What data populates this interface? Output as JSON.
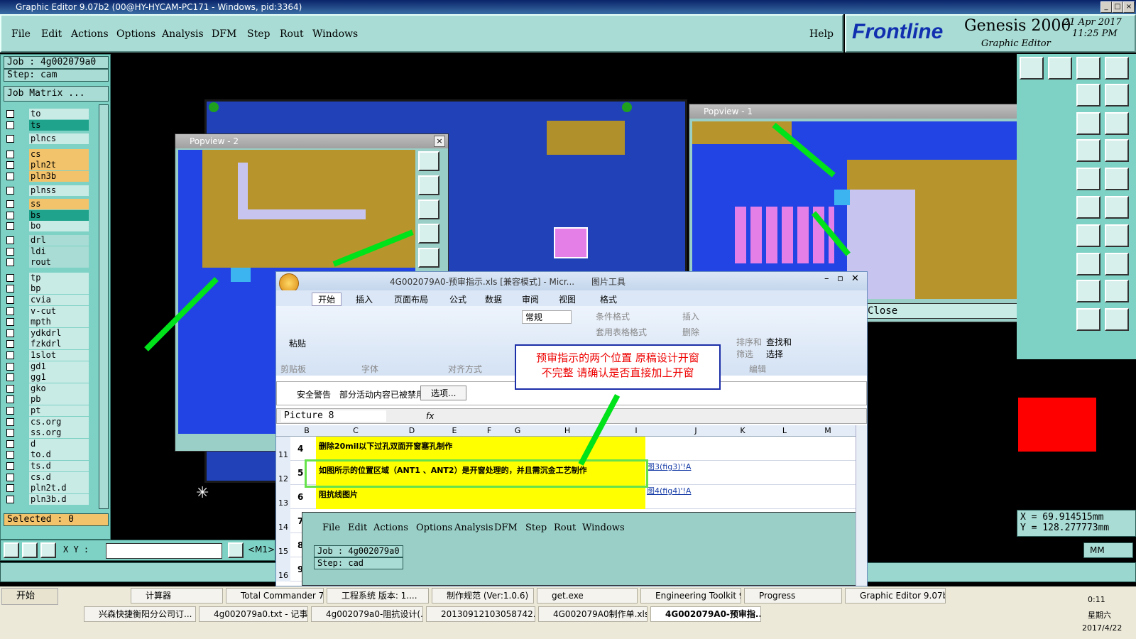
{
  "window": {
    "title": "Graphic Editor 9.07b2 (00@HY-HYCAM-PC171 - Windows, pid:3364)"
  },
  "menu": [
    "File",
    "Edit",
    "Actions",
    "Options",
    "Analysis",
    "DFM",
    "Step",
    "Rout",
    "Windows"
  ],
  "help": "Help",
  "brand": {
    "logo": "Frontline",
    "product": "Genesis 2000",
    "sub": "Graphic Editor",
    "date": "21 Apr 2017",
    "time": "11:25 PM"
  },
  "job": {
    "job": "Job : 4g002079a0",
    "step": "Step: cam",
    "matrix": "Job Matrix ...",
    "selected": "Selected : 0"
  },
  "layers": [
    "to",
    "ts",
    "plncs",
    "cs",
    "pln2t",
    "pln3b",
    "plnss",
    "ss",
    "bs",
    "bo",
    "drl",
    "ldi",
    "rout",
    "tp",
    "bp",
    "cvia",
    "v-cut",
    "mpth",
    "ydkdrl",
    "fzkdrl",
    "1slot",
    "gd1",
    "gg1",
    "gko",
    "pb",
    "pt",
    "cs.org",
    "ss.org",
    "d",
    "to.d",
    "ts.d",
    "cs.d",
    "pln2t.d",
    "pln3b.d"
  ],
  "pop1": {
    "title": "Popview - 1",
    "close": "Close"
  },
  "pop2": {
    "title": "Popview - 2"
  },
  "coords": {
    "x": "X = 69.914515mm",
    "y": "Y = 128.277773mm",
    "unit": "MM",
    "xy": "X Y :",
    "m1": "<M1>"
  },
  "excel": {
    "title": "4G002079A0-预审指示.xls [兼容模式] - Micr...",
    "tools": "图片工具",
    "tabs": [
      "开始",
      "插入",
      "页面布局",
      "公式",
      "数据",
      "审阅",
      "视图",
      "格式"
    ],
    "groups": [
      "剪贴板",
      "字体",
      "对齐方式",
      "编辑"
    ],
    "paste": "粘贴",
    "number": "常规",
    "cells": [
      "条件格式",
      "套用表格格式",
      "插入",
      "删除",
      "排序和筛选",
      "查找和选择"
    ],
    "security": {
      "label": "安全警告",
      "msg": "部分活动内容已被禁用。",
      "btn": "选项..."
    },
    "namebox": "Picture 8",
    "fx": "fx",
    "cols": [
      "B",
      "C",
      "D",
      "E",
      "F",
      "G",
      "H",
      "I",
      "J",
      "K",
      "L",
      "M"
    ],
    "rows": [
      {
        "r": "11",
        "n": "4",
        "t": "删除20mil以下过孔双面开窗塞孔制作",
        "j": ""
      },
      {
        "r": "12",
        "n": "5",
        "t": "如图所示的位置区域（ANT1 、ANT2）是开窗处理的，并且需沉金工艺制作",
        "j": "图3(fig3)'!A"
      },
      {
        "r": "13",
        "n": "6",
        "t": "阻抗线图片",
        "j": "图4(fig4)'!A"
      },
      {
        "r": "14",
        "n": "7",
        "t": "",
        "j": ""
      },
      {
        "r": "15",
        "n": "8",
        "t": "",
        "j": ""
      },
      {
        "r": "16",
        "n": "9",
        "t": "",
        "j": ""
      }
    ],
    "note1": "预审指示的两个位置  原稿设计开窗",
    "note2": "不完整  请确认是否直接加上开窗",
    "inner_job": "Job : 4g002079a0",
    "inner_step": "Step: cad"
  },
  "taskbar": {
    "start": "开始",
    "row1": [
      "计算器",
      "Total Commander 7.0 ...",
      "工程系统  版本: 1....",
      "制作规范 (Ver:1.0.6)",
      "get.exe",
      "Engineering Toolkit 9....",
      "Progress",
      "Graphic Editor 9.07b2 ..."
    ],
    "row2": [
      "兴森快捷衡阳分公司订...",
      "4g002079a0.txt - 记事本",
      "4g002079a0-阻抗设计(...",
      "20130912103058742.rtf...",
      "4G002079A0制作单.xls ...",
      "4G002079A0-预审指..."
    ],
    "clock": "0:11",
    "day": "星期六",
    "date": "2017/4/22"
  }
}
